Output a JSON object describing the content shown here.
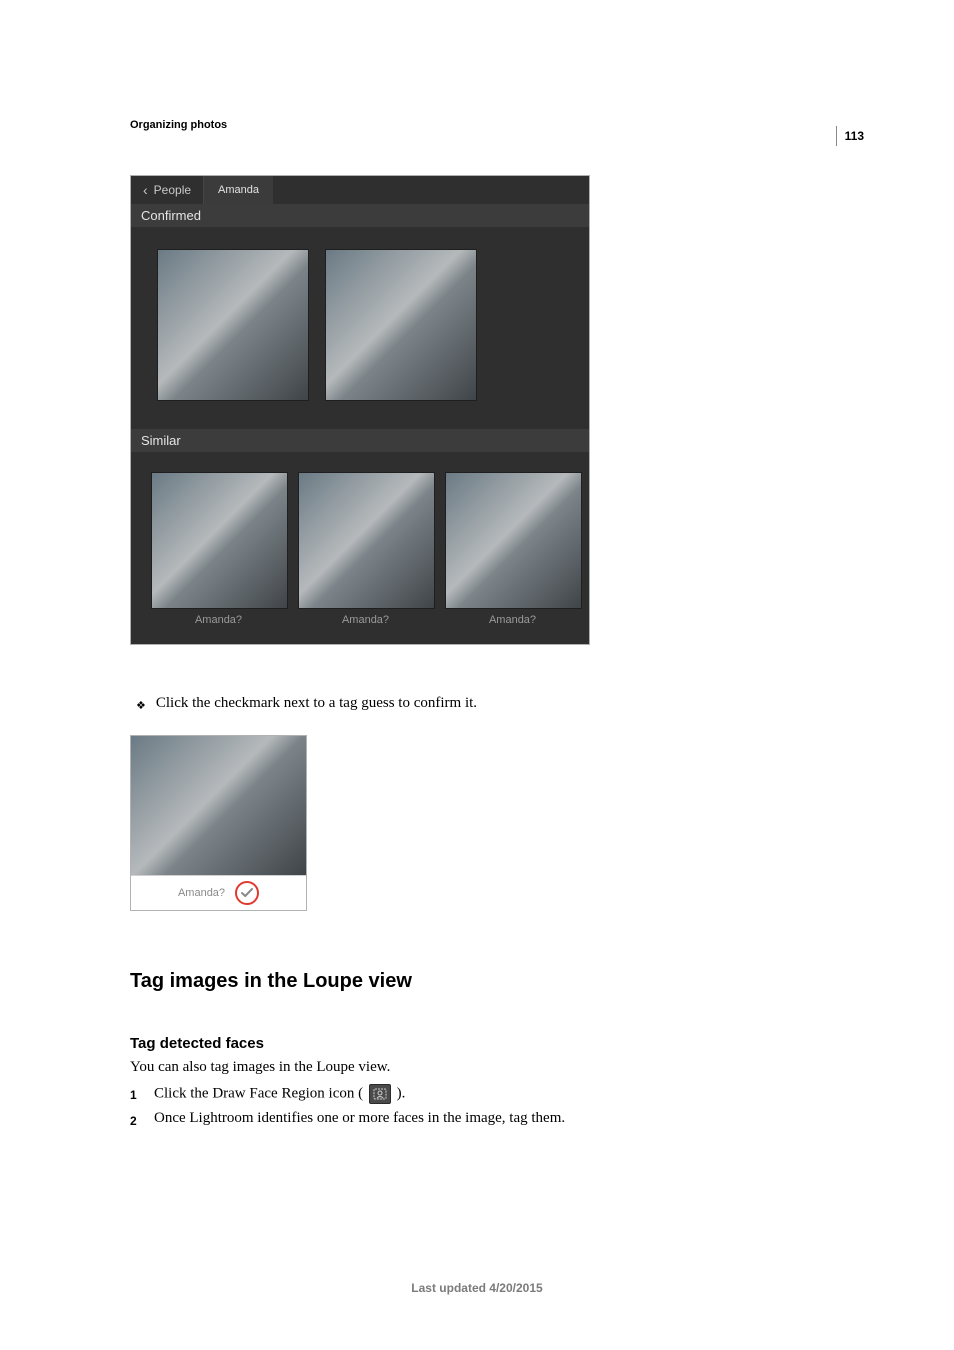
{
  "page_number": "113",
  "section_title": "Organizing photos",
  "shot": {
    "back_label": "People",
    "person_name": "Amanda",
    "confirmed_label": "Confirmed",
    "similar_label": "Similar",
    "similar_captions": [
      "Amanda?",
      "Amanda?",
      "Amanda?"
    ]
  },
  "bullet_text": "Click the checkmark next to a tag guess to confirm it.",
  "mini_caption": "Amanda?",
  "h2": "Tag images in the Loupe view",
  "h3": "Tag detected faces",
  "intro": "You can also tag images in the Loupe view.",
  "steps": {
    "s1a": "Click the Draw Face Region icon (",
    "s1b": ").",
    "s2": "Once Lightroom identifies one or more faces in the image, tag them."
  },
  "footer": "Last updated 4/20/2015"
}
